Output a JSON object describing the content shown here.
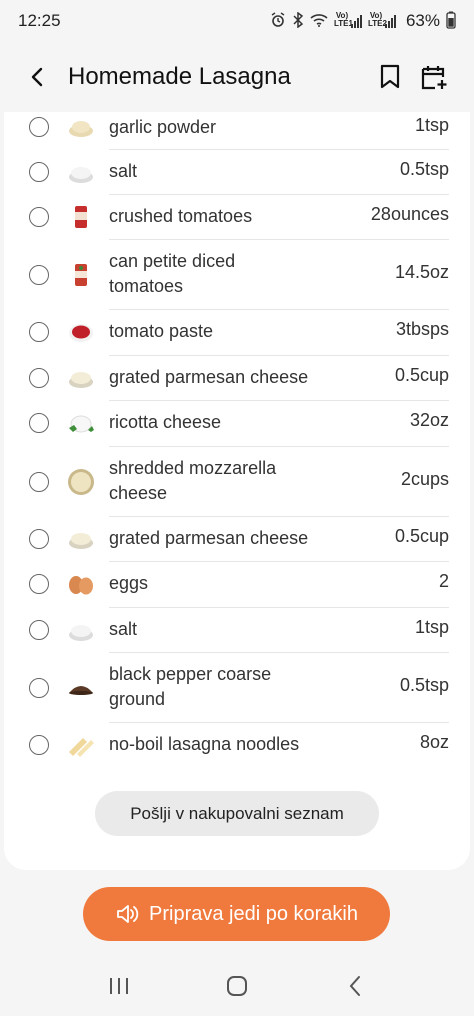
{
  "status": {
    "time": "12:25",
    "battery": "63%",
    "lte1": "Vo)) LTE1",
    "lte2": "Vo)) LTE2"
  },
  "header": {
    "title": "Homemade Lasagna",
    "back_icon": "back-arrow-icon",
    "bookmark_icon": "bookmark-icon",
    "calendar_icon": "calendar-add-icon"
  },
  "ingredients": [
    {
      "name": "garlic powder",
      "qty": "1tsp",
      "icon": "garlic-powder"
    },
    {
      "name": "salt",
      "qty": "0.5tsp",
      "icon": "salt"
    },
    {
      "name": "crushed tomatoes",
      "qty": "28ounces",
      "icon": "tomato-can"
    },
    {
      "name": "can petite diced tomatoes",
      "qty": "14.5oz",
      "icon": "tomato-can"
    },
    {
      "name": "tomato paste",
      "qty": "3tbsps",
      "icon": "tomato-paste"
    },
    {
      "name": "grated parmesan cheese",
      "qty": "0.5cup",
      "icon": "parmesan"
    },
    {
      "name": "ricotta cheese",
      "qty": "32oz",
      "icon": "ricotta"
    },
    {
      "name": "shredded mozzarella cheese",
      "qty": "2cups",
      "icon": "mozzarella"
    },
    {
      "name": "grated parmesan cheese",
      "qty": "0.5cup",
      "icon": "parmesan"
    },
    {
      "name": "eggs",
      "qty": "2",
      "icon": "eggs"
    },
    {
      "name": "salt",
      "qty": "1tsp",
      "icon": "salt"
    },
    {
      "name": "black pepper coarse ground",
      "qty": "0.5tsp",
      "icon": "black-pepper"
    },
    {
      "name": "no-boil lasagna noodles",
      "qty": "8oz",
      "icon": "noodles"
    }
  ],
  "send_button": "Pošlji v nakupovalni seznam",
  "cook_button": "Priprava jedi po korakih",
  "colors": {
    "accent": "#f07a3e",
    "card": "#ffffff",
    "background": "#f5f5f5"
  }
}
